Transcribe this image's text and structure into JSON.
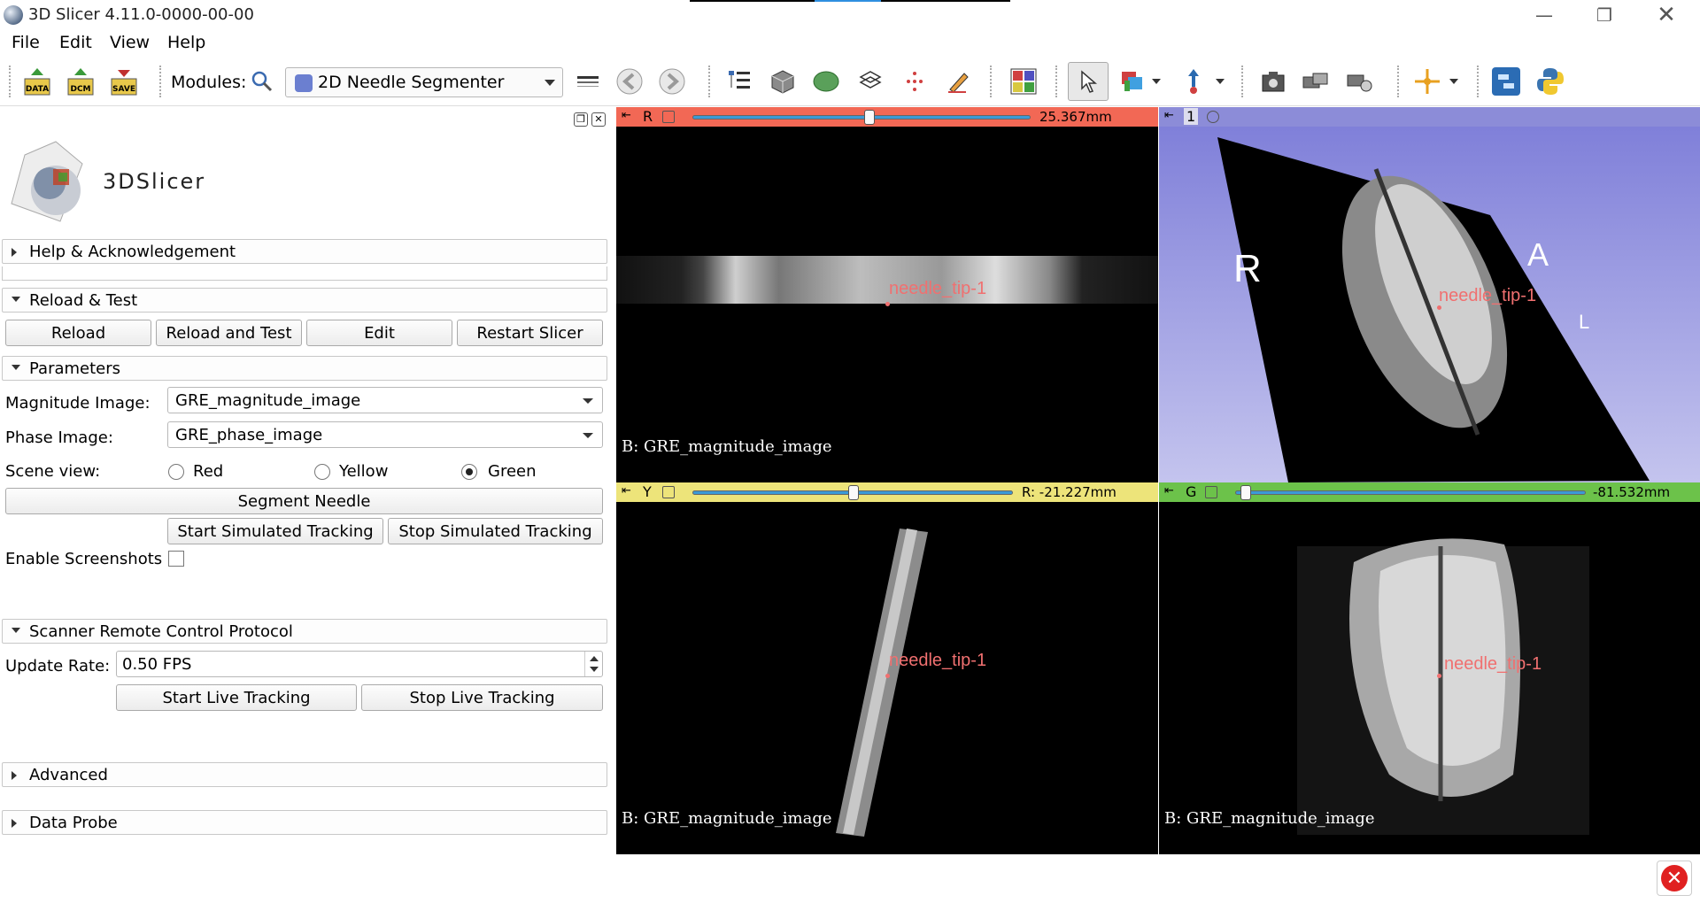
{
  "window": {
    "title": "3D Slicer 4.11.0-0000-00-00"
  },
  "menu": {
    "file": "File",
    "edit": "Edit",
    "view": "View",
    "help": "Help"
  },
  "toolbar": {
    "data": "DATA",
    "dcm": "DCM",
    "save": "SAVE",
    "modules_label": "Modules:",
    "module_selected": "2D Needle Segmenter"
  },
  "panel": {
    "logo_text": "3DSlicer",
    "help_section": "Help & Acknowledgement",
    "reload_section": "Reload & Test",
    "reload": "Reload",
    "reload_test": "Reload and Test",
    "edit": "Edit",
    "restart": "Restart Slicer",
    "params_section": "Parameters",
    "magnitude_label": "Magnitude Image:",
    "magnitude_value": "GRE_magnitude_image",
    "phase_label": "Phase Image:",
    "phase_value": "GRE_phase_image",
    "scene_label": "Scene view:",
    "red": "Red",
    "yellow": "Yellow",
    "green": "Green",
    "scene_selected": "Green",
    "segment": "Segment Needle",
    "start_sim": "Start Simulated Tracking",
    "stop_sim": "Stop Simulated Tracking",
    "screenshots_label": "Enable Screenshots",
    "screenshots_checked": false,
    "scanner_section": "Scanner Remote Control Protocol",
    "rate_label": "Update Rate:",
    "rate_value": "0.50 FPS",
    "start_live": "Start Live Tracking",
    "stop_live": "Stop Live Tracking",
    "advanced_section": "Advanced",
    "probe_section": "Data Probe"
  },
  "views": {
    "red": {
      "label": "R",
      "offset": "25.367mm",
      "slider_fraction": 0.53,
      "caption": "B: GRE_magnitude_image",
      "color": "#f26855"
    },
    "threed": {
      "label": "1",
      "color": "#8c8cd8"
    },
    "yellow": {
      "label": "Y",
      "offset": "R: -21.227mm",
      "slider_fraction": 0.49,
      "caption": "B: GRE_magnitude_image",
      "color": "#ede47a"
    },
    "green": {
      "label": "G",
      "offset": "-81.532mm",
      "slider_fraction": 0.04,
      "caption": "B: GRE_magnitude_image",
      "color": "#6cc24a"
    },
    "needle_label": "needle_tip-1",
    "orient_r": "R",
    "orient_a": "A",
    "orient_l": "L"
  }
}
